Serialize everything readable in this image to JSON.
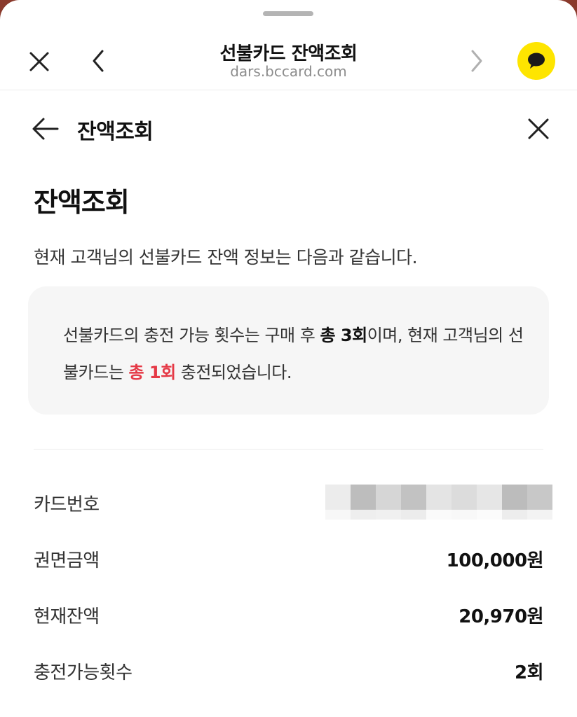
{
  "browser": {
    "title": "선불카드 잔액조회",
    "url": "dars.bccard.com"
  },
  "page_header": {
    "title": "잔액조회"
  },
  "content": {
    "heading": "잔액조회",
    "description": "현재 고객님의 선불카드 잔액 정보는 다음과 같습니다.",
    "notice": {
      "part1": "선불카드의 충전 가능 횟수는 구매 후 ",
      "total_count": "총 3회",
      "part2": "이며, 현재 고객님의 선불카드는 ",
      "charged_count": "총 1회",
      "part3": " 충전되었습니다."
    }
  },
  "details": [
    {
      "label": "카드번호",
      "value": ""
    },
    {
      "label": "권면금액",
      "value": "100,000원"
    },
    {
      "label": "현재잔액",
      "value": "20,970원"
    },
    {
      "label": "충전가능횟수",
      "value": "2회"
    }
  ],
  "colors": {
    "accent_red": "#e53946",
    "kakao_yellow": "#fee500",
    "notice_bg": "#f6f6f6"
  },
  "icons": {
    "browser_close": "close-icon",
    "browser_back": "chevron-left-icon",
    "browser_forward": "chevron-right-icon",
    "talk": "kakao-talk-icon",
    "page_back": "arrow-left-icon",
    "page_close": "close-icon"
  }
}
